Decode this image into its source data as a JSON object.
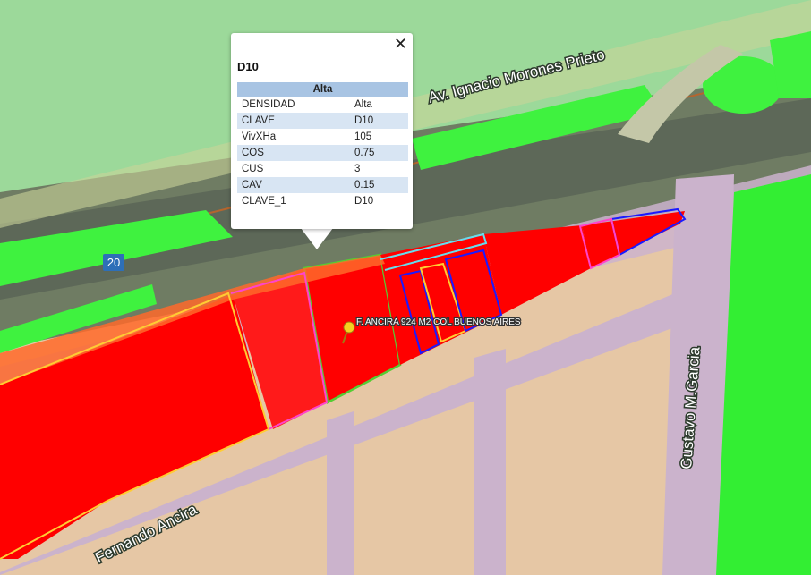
{
  "map": {
    "roads": {
      "main_avenue": "Av. Ignacio Morones Prieto",
      "bottom_street": "Fernando Ancira",
      "right_street": "Gustavo M.Garcia"
    },
    "route_shield": "20",
    "pin": {
      "icon": "pushpin-icon",
      "label": "F. ANCIRA 924 M2 COL BUENOS AIRES"
    },
    "colors": {
      "alta_density": "#ff0000",
      "green_zone": "#33ee33",
      "light_green": "#a8e0a0",
      "residential": "#e8c9a8",
      "street": "#cbb3cc"
    }
  },
  "popup": {
    "title": "D10",
    "close_label": "✕",
    "header": "Alta",
    "rows": [
      {
        "key": "DENSIDAD",
        "value": "Alta"
      },
      {
        "key": "CLAVE",
        "value": "D10"
      },
      {
        "key": "VivXHa",
        "value": "105"
      },
      {
        "key": "COS",
        "value": "0.75"
      },
      {
        "key": "CUS",
        "value": "3"
      },
      {
        "key": "CAV",
        "value": "0.15"
      },
      {
        "key": "CLAVE_1",
        "value": "D10"
      }
    ]
  }
}
